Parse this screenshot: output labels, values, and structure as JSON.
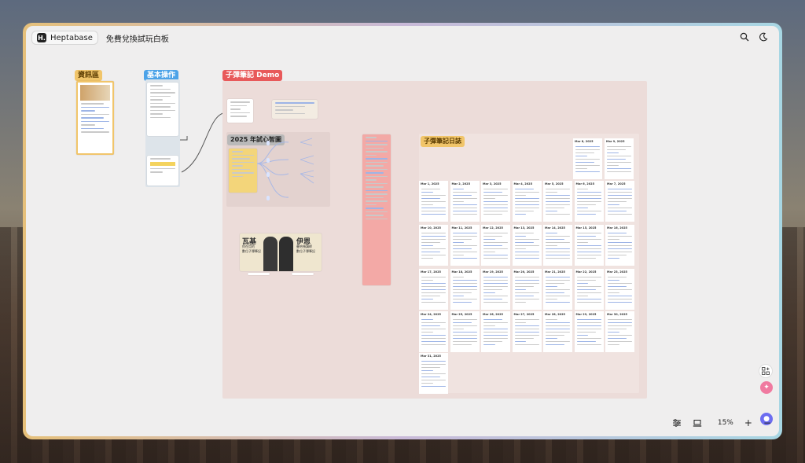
{
  "app": {
    "name": "Heptabase",
    "logo_letter": "H.",
    "whiteboard_title": "免費兌換試玩白板"
  },
  "toolbar": {
    "search_icon": "search-icon",
    "theme_icon": "moon-icon"
  },
  "sections": {
    "info": {
      "label": "資訊區",
      "color": "#f1c56a"
    },
    "basic": {
      "label": "基本操作",
      "color": "#4da3e8"
    },
    "demo": {
      "label": "子彈筆記 Demo",
      "color": "#e8595a"
    },
    "mindmap": {
      "label": "2025 年試心智圖",
      "color": "#b9b9b9"
    },
    "journal": {
      "label": "子彈筆記日誌",
      "color": "#f1c56a"
    }
  },
  "poster": {
    "left_name": "瓦基",
    "left_sub": "你在用的",
    "left_tag": "數位子彈筆記",
    "right_name": "伊恩",
    "right_sub": "曼哈頓講師",
    "right_tag": "數位子彈筆記"
  },
  "journal_dates": [
    "Mar 8, 2025",
    "Mar 9, 2025",
    "Mar 1, 2025",
    "Mar 2, 2025",
    "Mar 3, 2025",
    "Mar 4, 2025",
    "Mar 5, 2025",
    "Mar 6, 2025",
    "Mar 7, 2025",
    "Mar 10, 2025",
    "Mar 11, 2025",
    "Mar 12, 2025",
    "Mar 13, 2025",
    "Mar 14, 2025",
    "Mar 15, 2025",
    "Mar 16, 2025",
    "Mar 17, 2025",
    "Mar 18, 2025",
    "Mar 19, 2025",
    "Mar 20, 2025",
    "Mar 21, 2025",
    "Mar 22, 2025",
    "Mar 23, 2025",
    "Mar 24, 2025",
    "Mar 25, 2025",
    "Mar 26, 2025",
    "Mar 27, 2025",
    "Mar 28, 2025",
    "Mar 29, 2025",
    "Mar 30, 2025",
    "Mar 31, 2025"
  ],
  "bottom": {
    "zoom": "15%",
    "plus": "+",
    "minus": "−"
  }
}
